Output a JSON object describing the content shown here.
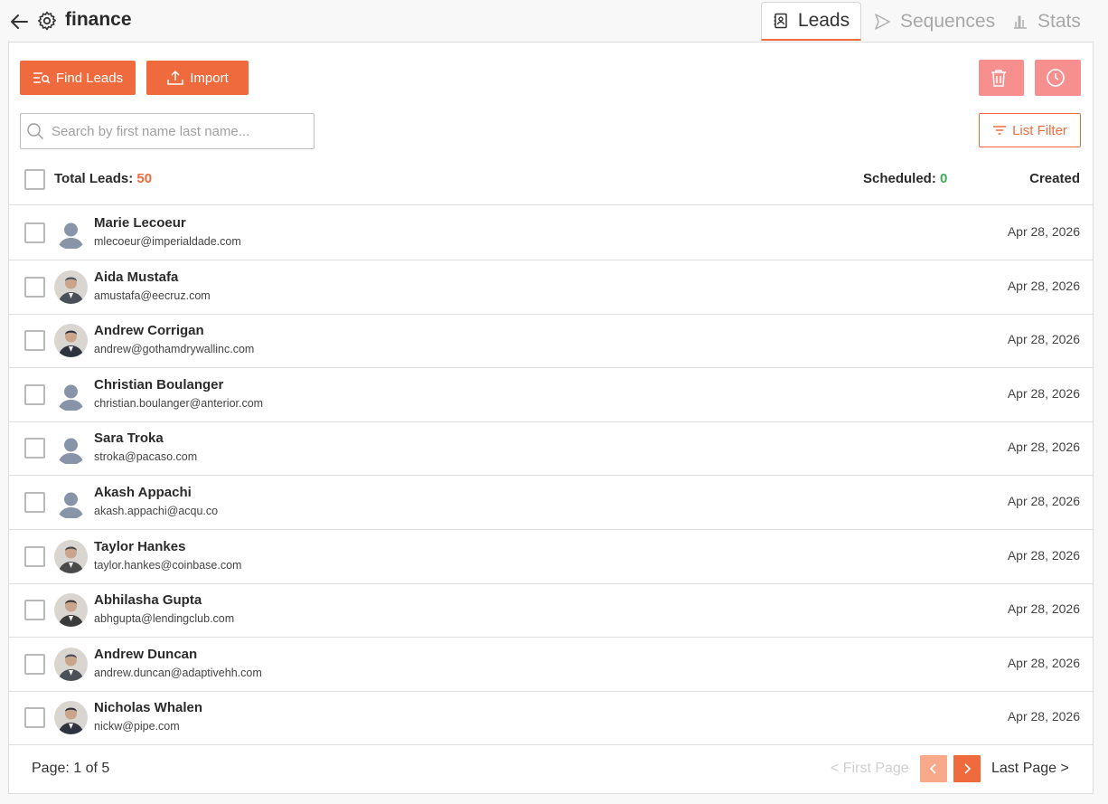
{
  "header": {
    "title": "finance",
    "tabs": [
      {
        "label": "Leads",
        "icon": "contact-book-icon",
        "active": true
      },
      {
        "label": "Sequences",
        "icon": "send-icon",
        "active": false
      },
      {
        "label": "Stats",
        "icon": "bar-chart-icon",
        "active": false
      }
    ]
  },
  "toolbar": {
    "find_label": "Find Leads",
    "import_label": "Import",
    "search_placeholder": "Search by first name last name...",
    "filter_label": "List Filter"
  },
  "summary": {
    "total_label": "Total Leads:",
    "total_value": "50",
    "scheduled_label": "Scheduled:",
    "scheduled_value": "0",
    "created_label": "Created"
  },
  "leads": [
    {
      "name": "Marie Lecoeur",
      "email": "mlecoeur@imperialdade.com",
      "date": "Apr 28, 2026",
      "avatar": "placeholder"
    },
    {
      "name": "Aida Mustafa",
      "email": "amustafa@eecruz.com",
      "date": "Apr 28, 2026",
      "avatar": "photo"
    },
    {
      "name": "Andrew Corrigan",
      "email": "andrew@gothamdrywallinc.com",
      "date": "Apr 28, 2026",
      "avatar": "photo"
    },
    {
      "name": "Christian Boulanger",
      "email": "christian.boulanger@anterior.com",
      "date": "Apr 28, 2026",
      "avatar": "placeholder"
    },
    {
      "name": "Sara Troka",
      "email": "stroka@pacaso.com",
      "date": "Apr 28, 2026",
      "avatar": "placeholder"
    },
    {
      "name": "Akash Appachi",
      "email": "akash.appachi@acqu.co",
      "date": "Apr 28, 2026",
      "avatar": "placeholder"
    },
    {
      "name": "Taylor Hankes",
      "email": "taylor.hankes@coinbase.com",
      "date": "Apr 28, 2026",
      "avatar": "photo"
    },
    {
      "name": "Abhilasha Gupta",
      "email": "abhgupta@lendingclub.com",
      "date": "Apr 28, 2026",
      "avatar": "photo"
    },
    {
      "name": "Andrew Duncan",
      "email": "andrew.duncan@adaptivehh.com",
      "date": "Apr 28, 2026",
      "avatar": "photo"
    },
    {
      "name": "Nicholas Whalen",
      "email": "nickw@pipe.com",
      "date": "Apr 28, 2026",
      "avatar": "photo"
    }
  ],
  "pagination": {
    "page_info": "Page: 1 of 5",
    "first_label": "< First Page",
    "last_label": "Last Page >"
  },
  "colors": {
    "accent": "#ef6b3e",
    "danger_soft": "#f88f8f",
    "success": "#3fae55"
  }
}
